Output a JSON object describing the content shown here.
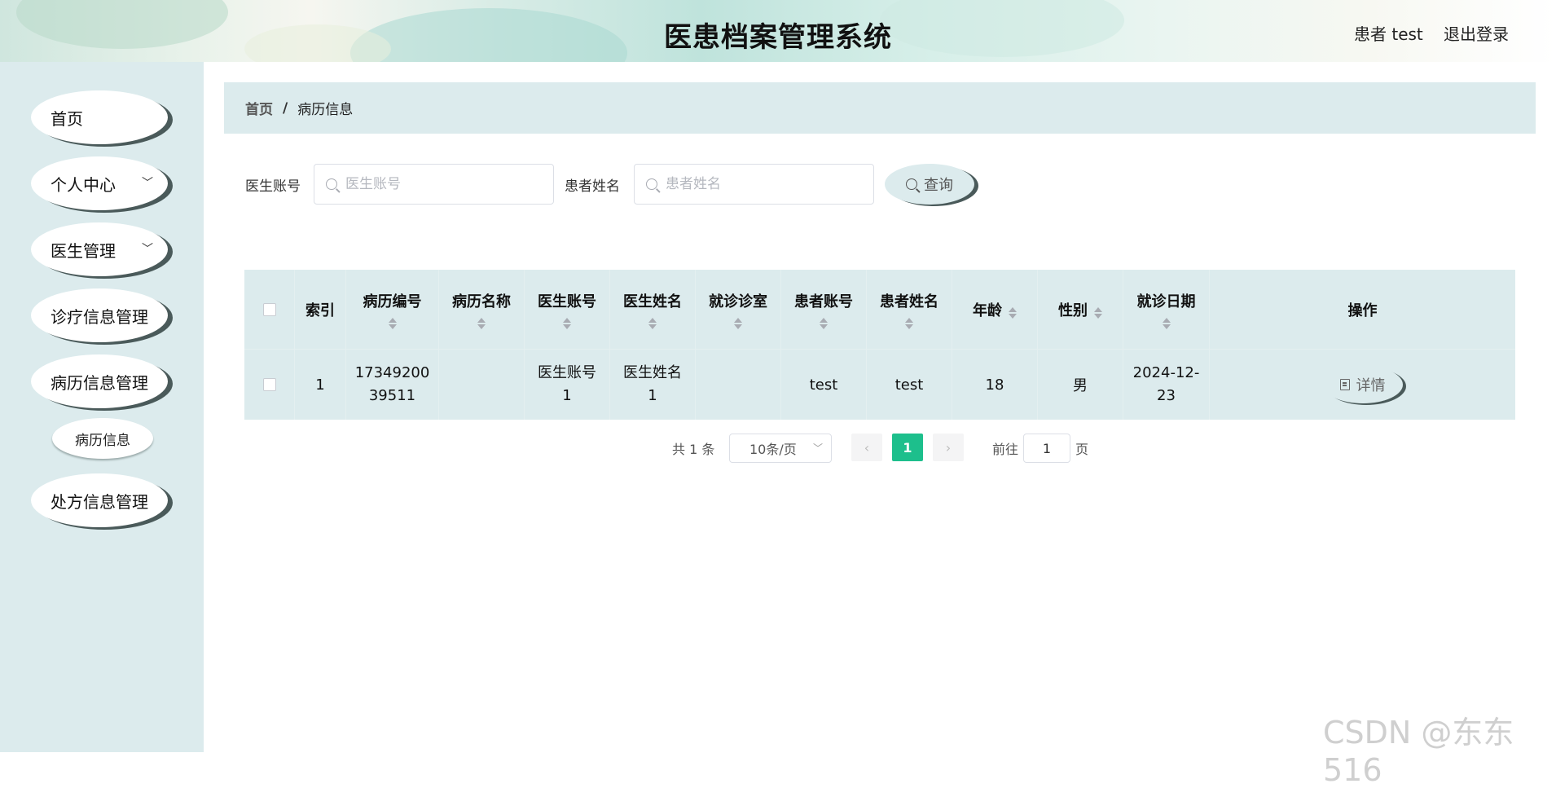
{
  "header": {
    "title": "医患档案管理系统",
    "user": "患者 test",
    "logout": "退出登录"
  },
  "sidebar": {
    "items": [
      {
        "label": "首页",
        "has_children": false
      },
      {
        "label": "个人中心",
        "has_children": true
      },
      {
        "label": "医生管理",
        "has_children": true
      },
      {
        "label": "诊疗信息管理",
        "has_children": true
      },
      {
        "label": "病历信息管理",
        "has_children": true
      },
      {
        "label": "处方信息管理",
        "has_children": true
      }
    ],
    "sub_item": "病历信息"
  },
  "breadcrumb": {
    "home": "首页",
    "separator": "/",
    "current": "病历信息"
  },
  "search": {
    "doctor_account_label": "医生账号",
    "doctor_account_placeholder": "医生账号",
    "patient_name_label": "患者姓名",
    "patient_name_placeholder": "患者姓名",
    "query_button": "查询"
  },
  "table": {
    "headers": [
      "索引",
      "病历编号",
      "病历名称",
      "医生账号",
      "医生姓名",
      "就诊诊室",
      "患者账号",
      "患者姓名",
      "年龄",
      "性别",
      "就诊日期",
      "操作"
    ],
    "rows": [
      {
        "index": "1",
        "record_no": "1734920039511",
        "record_no_line1": "17349200",
        "record_no_line2": "39511",
        "record_name": "",
        "doctor_account_line1": "医生账号",
        "doctor_account_line2": "1",
        "doctor_name_line1": "医生姓名",
        "doctor_name_line2": "1",
        "clinic_room": "",
        "patient_account": "test",
        "patient_name": "test",
        "age": "18",
        "gender": "男",
        "visit_date_line1": "2024-12-",
        "visit_date_line2": "23",
        "action": "详情"
      }
    ]
  },
  "pagination": {
    "total": "共 1 条",
    "page_size": "10条/页",
    "current_page": "1",
    "goto_label": "前往",
    "goto_value": "1",
    "page_suffix": "页",
    "prev_icon": "‹",
    "next_icon": "›"
  },
  "watermark": "CSDN @东东516",
  "colors": {
    "accent": "#1dbf8c",
    "panel": "#dcebed",
    "shadow": "#4a5a5a"
  }
}
